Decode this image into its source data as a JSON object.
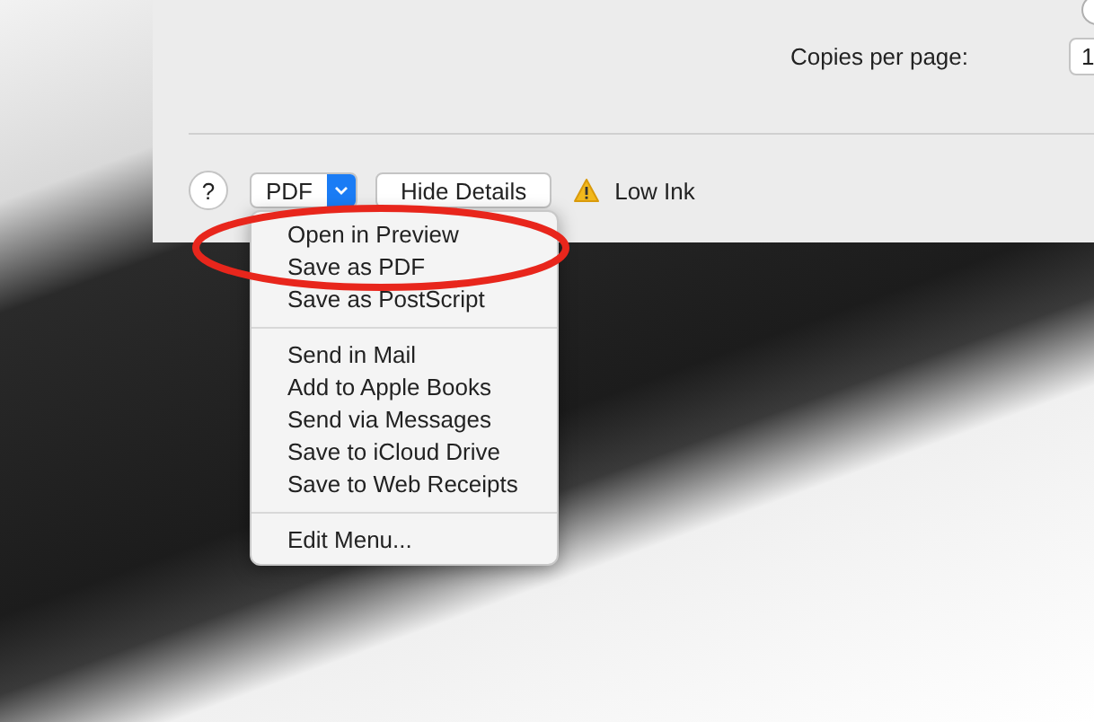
{
  "dialog": {
    "radio": {
      "selected": false
    },
    "copies_per_page": {
      "label": "Copies per page:",
      "value": "1"
    },
    "help_button": "?",
    "pdf_button": {
      "label": "PDF",
      "expanded": true
    },
    "hide_details_button": "Hide Details",
    "warning": "Low Ink"
  },
  "pdf_menu": {
    "groups": [
      {
        "items": [
          "Open in Preview",
          "Save as PDF",
          "Save as PostScript"
        ]
      },
      {
        "items": [
          "Send in Mail",
          "Add to Apple Books",
          "Send via Messages",
          "Save to iCloud Drive",
          "Save to Web Receipts"
        ]
      },
      {
        "items": [
          "Edit Menu..."
        ]
      }
    ]
  },
  "annotation": {
    "kind": "ellipse",
    "color": "#e8261c"
  }
}
